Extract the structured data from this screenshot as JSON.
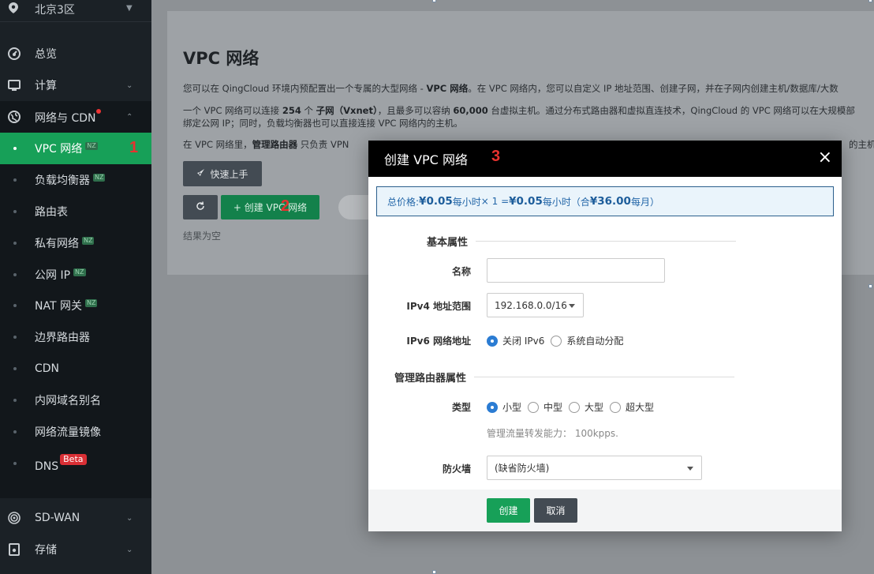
{
  "sidebar": {
    "region": "北京3区",
    "items": [
      {
        "label": "总览",
        "icon": "dashboard-icon"
      },
      {
        "label": "计算",
        "icon": "monitor-icon"
      },
      {
        "label": "网络与 CDN",
        "icon": "globe-icon"
      },
      {
        "label": "VPC 网络",
        "badge": "NZ"
      },
      {
        "label": "负载均衡器",
        "badge": "NZ"
      },
      {
        "label": "路由表"
      },
      {
        "label": "私有网络",
        "badge": "NZ"
      },
      {
        "label": "公网 IP",
        "badge": "NZ"
      },
      {
        "label": "NAT 网关",
        "badge": "NZ"
      },
      {
        "label": "边界路由器"
      },
      {
        "label": "CDN"
      },
      {
        "label": "内网域名别名"
      },
      {
        "label": "网络流量镜像"
      },
      {
        "label": "DNS",
        "badge": "Beta"
      },
      {
        "label": "SD-WAN",
        "icon": "sdwan-icon"
      },
      {
        "label": "存储",
        "icon": "storage-icon"
      }
    ]
  },
  "markers": {
    "m1": "1",
    "m2": "2",
    "m3": "3"
  },
  "main": {
    "title": "VPC 网络",
    "para1_a": "您可以在 QingCloud 环境内预配置出一个专属的大型网络 - ",
    "para1_b": "VPC 网络",
    "para1_c": "。在 VPC 网络内，您可以自定义 IP 地址范围、创建子网，并在子网内创建主机/数据库/大数",
    "para2_a": "一个 VPC 网络可以连接 ",
    "para2_b": "254",
    "para2_c": " 个 ",
    "para2_d": "子网（Vxnet）",
    "para2_e": "，且最多可以容纳 ",
    "para2_f": "60,000",
    "para2_g": " 台虚拟主机。通过分布式路由器和虚拟直连技术，QingCloud 的 VPC 网络可以在大规模部",
    "para3": "绑定公网 IP；同时，负载均衡器也可以直接连接 VPC 网络内的主机。",
    "para4_a": "在 VPC 网络里，",
    "para4_b": "管理路由器",
    "para4_c": " 只负责 VPN",
    "para4_d": "的主机",
    "quick_start": "快速上手",
    "create_button": "+ 创建 VPC 网络",
    "empty": "结果为空"
  },
  "dialog": {
    "title": "创建 VPC 网络",
    "close": "×",
    "price": {
      "label": "总价格: ",
      "unit_price": "¥0.05",
      "per_hour_1": " 每小时 ",
      "times": " × 1 = ",
      "total": "¥0.05",
      "per_hour_2": " 每小时（合 ",
      "monthly": "¥36.00",
      "per_month": " 每月）"
    },
    "section_basic": "基本属性",
    "name_label": "名称",
    "name_value": "",
    "ipv4_label": "IPv4 地址范围",
    "ipv4_value": "192.168.0.0/16",
    "ipv6_label": "IPv6 网络地址",
    "ipv6_options": [
      "关闭 IPv6",
      "系统自动分配"
    ],
    "section_router": "管理路由器属性",
    "type_label": "类型",
    "type_options": [
      "小型",
      "中型",
      "大型",
      "超大型"
    ],
    "capacity_hint": "管理流量转发能力： 100kpps.",
    "firewall_label": "防火墙",
    "firewall_value": "(缺省防火墙)",
    "ok": "创建",
    "cancel": "取消"
  },
  "colors": {
    "accent": "#17a058",
    "sidebar_bg": "#1b2126",
    "price_text": "#2366a8",
    "radio_on": "#2b7cd3"
  }
}
